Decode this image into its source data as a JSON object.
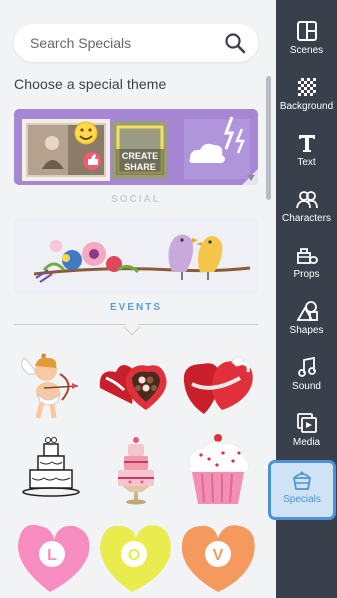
{
  "search": {
    "placeholder": "Search Specials"
  },
  "heading": "Choose a special theme",
  "themes": [
    {
      "label": "SOCIAL"
    },
    {
      "label": "EVENTS"
    }
  ],
  "social_card": {
    "tile_text_1": "CREATE",
    "tile_text_2": "SHARE"
  },
  "grid_items": [
    "cupid-icon",
    "chocolate-box-icon",
    "heart-gift-box-icon",
    "wedding-cake-outline-icon",
    "wedding-cake-icon",
    "cupcake-icon",
    "heart-candy-l-icon",
    "heart-candy-o-icon",
    "heart-candy-v-icon"
  ],
  "heart_letters": [
    "L",
    "O",
    "V"
  ],
  "sidebar": {
    "items": [
      {
        "label": "Scenes",
        "icon": "scenes-icon"
      },
      {
        "label": "Background",
        "icon": "background-icon"
      },
      {
        "label": "Text",
        "icon": "text-icon"
      },
      {
        "label": "Characters",
        "icon": "characters-icon"
      },
      {
        "label": "Props",
        "icon": "props-icon"
      },
      {
        "label": "Shapes",
        "icon": "shapes-icon"
      },
      {
        "label": "Sound",
        "icon": "sound-icon"
      },
      {
        "label": "Media",
        "icon": "media-icon"
      },
      {
        "label": "Specials",
        "icon": "specials-icon"
      }
    ],
    "active": "Specials"
  },
  "colors": {
    "panel_bg": "#f2f3f5",
    "sidebar_bg": "#3a3f4c",
    "accent": "#4b93d6",
    "social_card_bg": "#a786d4"
  }
}
